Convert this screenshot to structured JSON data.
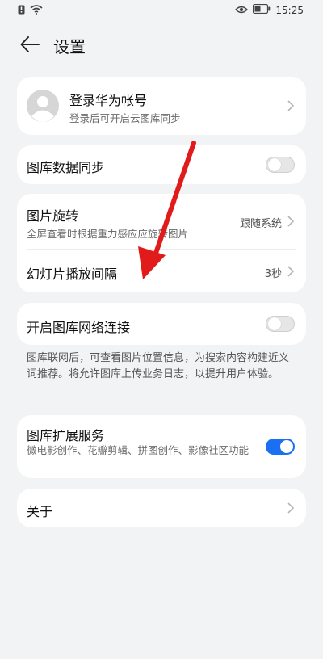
{
  "status_bar": {
    "time": "15:25",
    "icons": [
      "notification-icon",
      "wifi-icon",
      "eye-icon",
      "battery-icon"
    ]
  },
  "header": {
    "title": "设置",
    "back_icon": "back-arrow-icon"
  },
  "account": {
    "title": "登录华为帐号",
    "subtitle": "登录后可开启云图库同步"
  },
  "gallery_sync": {
    "label": "图库数据同步",
    "enabled": false
  },
  "display": {
    "rotation": {
      "title": "图片旋转",
      "subtitle": "全屏查看时根据重力感应应旋转图片",
      "value": "跟随系统"
    },
    "slideshow": {
      "title": "幻灯片播放间隔",
      "value": "3秒"
    }
  },
  "network": {
    "label": "开启图库网络连接",
    "enabled": false,
    "note": "图库联网后，可查看图片位置信息，为搜索内容构建近义词推荐。将允许图库上传业务日志，以提升用户体验。"
  },
  "extension": {
    "title": "图库扩展服务",
    "subtitle": "微电影创作、花瓣剪辑、拼图创作、影像社区功能",
    "enabled": true
  },
  "about": {
    "label": "关于"
  },
  "colors": {
    "accent": "#1a6ff2",
    "background": "#f1f3f5",
    "annotation_arrow": "#e11b1b"
  }
}
